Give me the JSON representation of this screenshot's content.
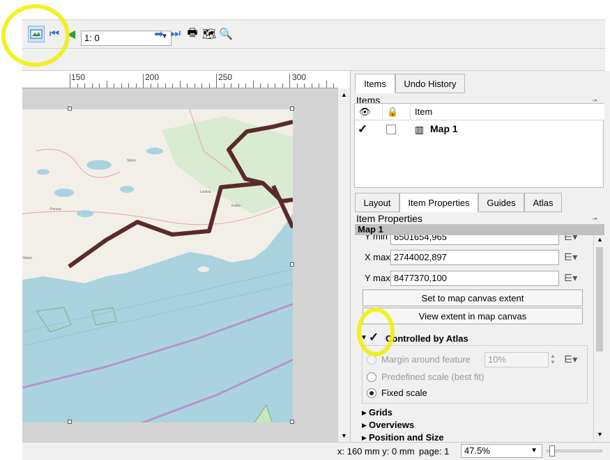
{
  "toolbar": {
    "atlas_page_value": "1: 0"
  },
  "ruler": {
    "labels": [
      "150",
      "200",
      "250",
      "300"
    ]
  },
  "map_labels": {
    "town1": "Porvoo",
    "town2": "Sipoo",
    "town3": "Vaasa",
    "town4": "Loviisa",
    "town5": "Kotka"
  },
  "right_panel": {
    "tabs_top": [
      "Items",
      "Undo History"
    ],
    "items_title": "Items",
    "items_header_item": "Item",
    "item_name": "Map 1",
    "tabs_bottom": [
      "Layout",
      "Item Properties",
      "Guides",
      "Atlas"
    ],
    "item_properties_title": "Item Properties",
    "current_item": "Map 1",
    "y_min_label": "Y min",
    "y_min_value": "6501654,965",
    "x_max_label": "X max",
    "x_max_value": "2744002,897",
    "y_max_label": "Y max",
    "y_max_value": "8477370,100",
    "set_extent_btn": "Set to map canvas extent",
    "view_extent_btn": "View extent in map canvas",
    "controlled_by_atlas": "Controlled by Atlas",
    "margin_label": "Margin around feature",
    "margin_value": "10%",
    "predefined_scale": "Predefined scale (best fit)",
    "fixed_scale": "Fixed scale",
    "sections": [
      "Grids",
      "Overviews",
      "Position and Size"
    ]
  },
  "status": {
    "coords": "x: 160 mm y: 0 mm",
    "page": "page: 1",
    "zoom": "47.5%"
  },
  "colors": {
    "route": "#5a2a2a",
    "water": "#aad3df",
    "land": "#f2efe9",
    "highlight": "#f0f000"
  }
}
